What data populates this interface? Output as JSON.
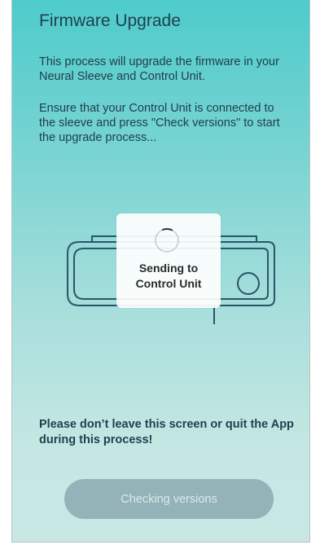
{
  "screen": {
    "title": "Firmware Upgrade",
    "intro": "This process will upgrade the firmware in your Neural Sleeve and Control Unit.",
    "instructions": "Ensure that your Control Unit is connected to the sleeve and press \"Check versions\" to start the upgrade process...",
    "device_icon": "control-unit-outline-icon"
  },
  "progress_hud": {
    "icon": "activity-spinner-icon",
    "message": "Sending to\nControl Unit"
  },
  "warning": "Please don’t leave this screen or quit the App during this process!",
  "action_button": {
    "label": "Checking versions",
    "state": "disabled"
  },
  "colors": {
    "gradient_top": "#4ecbcb",
    "gradient_bottom": "#c8e7e4",
    "text": "#1f3f4e",
    "device_stroke": "#2c5567",
    "button_bg": "#93b3b8"
  }
}
